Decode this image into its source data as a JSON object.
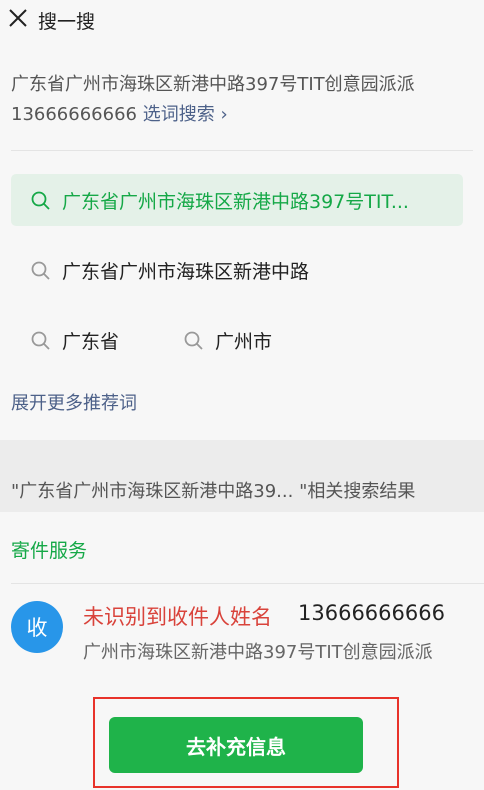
{
  "header": {
    "title": "搜一搜"
  },
  "query": {
    "text": "广东省广州市海珠区新港中路397号TIT创意园派派 13666666666",
    "pick_label": "选词搜索 ›"
  },
  "suggestions": [
    {
      "text": "广东省广州市海珠区新港中路397号TIT...",
      "highlighted": true
    },
    {
      "text": "广东省广州市海珠区新港中路"
    },
    {
      "text": "广东省"
    },
    {
      "text": "广州市"
    }
  ],
  "more_label": "展开更多推荐词",
  "results_header": "\"广东省广州市海珠区新港中路39... \"相关搜索结果",
  "service": {
    "title": "寄件服务",
    "avatar_text": "收",
    "recipient_warning": "未识别到收件人姓名",
    "phone": "13666666666",
    "address": "广州市海珠区新港中路397号TIT创意园派派",
    "button_label": "去补充信息"
  },
  "colors": {
    "accent_green": "#15a847",
    "button_green": "#1fb34a",
    "warning_red": "#d9433b",
    "avatar_blue": "#2896e9",
    "annotation_red": "#e8322a"
  },
  "icons": [
    "close-icon",
    "search-icon"
  ]
}
